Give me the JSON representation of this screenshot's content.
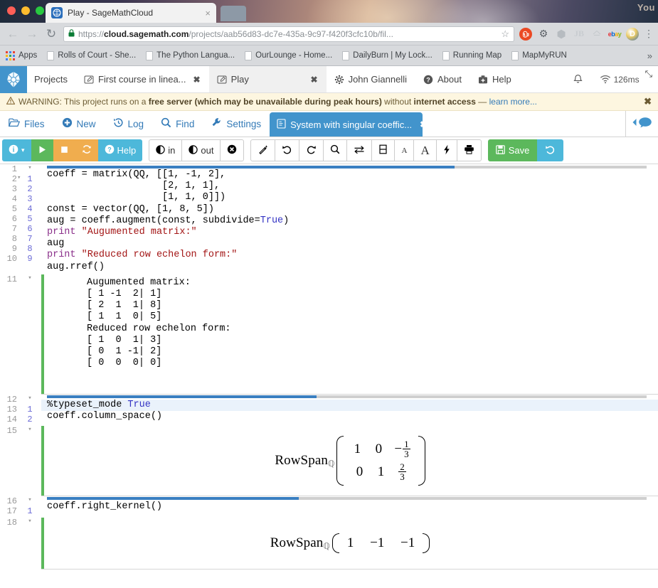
{
  "browser": {
    "tab_title": "Play - SageMathCloud",
    "tab_close": "×",
    "back_icon": "←",
    "forward_icon": "→",
    "reload_icon": "↻",
    "lock_icon": "🔒",
    "url_prefix": "https://",
    "url_domain": "cloud.sagemath.com",
    "url_path": "/projects/aab56d83-dc7e-435a-9c97-f420f3cfc10b/fil...",
    "star_icon": "☆",
    "menu_icon": "⋮",
    "watermark": "You",
    "extensions": [
      {
        "name": "stumbleupon-extension-icon",
        "label": "su"
      },
      {
        "name": "bug-extension-icon",
        "label": "⚙"
      },
      {
        "name": "box-extension-icon",
        "label": "⬢"
      },
      {
        "name": "jb-extension-icon",
        "label": "JB"
      },
      {
        "name": "amazon-extension-icon",
        "label": "a"
      },
      {
        "name": "ebay-extension-icon",
        "label": "ebay"
      },
      {
        "name": "d-extension-icon",
        "label": "D"
      }
    ],
    "bookmarks": [
      {
        "label": "Apps",
        "icon": "apps-grid-icon"
      },
      {
        "label": "Rolls of Court - She...",
        "icon": "page-icon"
      },
      {
        "label": "The Python Langua...",
        "icon": "page-icon"
      },
      {
        "label": "OurLounge - Home...",
        "icon": "page-icon"
      },
      {
        "label": "DailyBurn | My Lock...",
        "icon": "page-icon"
      },
      {
        "label": "Running Map",
        "icon": "page-icon"
      },
      {
        "label": "MapMyRUN",
        "icon": "page-icon"
      }
    ],
    "bookmarks_overflow": "»"
  },
  "smc_nav": {
    "projects": "Projects",
    "tabs": [
      {
        "label": "First course in linea...",
        "icon": "edit-icon",
        "close": "✖",
        "active": false
      },
      {
        "label": "Play",
        "icon": "edit-icon",
        "close": "✖",
        "active": true
      }
    ],
    "account": "John Giannelli",
    "about": "About",
    "help": "Help",
    "bell_icon": "🔔",
    "wifi_icon": "◔",
    "ping": "126ms",
    "pin_icon": "⤡"
  },
  "warning": {
    "icon": "⚠",
    "prefix": "WARNING: This project runs on a ",
    "bold1": "free server (which may be unavailable during peak hours)",
    "middle": " without ",
    "bold2": "internet access",
    "dash": " — ",
    "link": "learn more...",
    "close": "✖"
  },
  "project_tabs": {
    "items": [
      {
        "label": "Files",
        "icon": "folder-icon"
      },
      {
        "label": "New",
        "icon": "plus-circle-icon"
      },
      {
        "label": "Log",
        "icon": "history-icon"
      },
      {
        "label": "Find",
        "icon": "search-icon"
      },
      {
        "label": "Settings",
        "icon": "wrench-icon"
      }
    ],
    "file_tab": {
      "label": "System with singular coeffic...",
      "icon": "worksheet-icon",
      "close": "✖"
    },
    "chat_icon": "chat-bubble-icon"
  },
  "toolbar": {
    "info_label": "",
    "info_caret": "▾",
    "run_label": "▶",
    "stop_label": "■",
    "restart_label": "⟳",
    "help_label": "Help",
    "tighten_in": "in",
    "tighten_out": "out",
    "clear_label": "",
    "format_label": "",
    "undo_label": "↶",
    "redo_label": "↷",
    "find_label": "",
    "swap_label": "⇄",
    "split_label": "",
    "font_small": "A",
    "font_large": "A",
    "bolt_label": "⚡",
    "print_label": "",
    "save_label": "Save",
    "timetravel_label": "↺"
  },
  "worksheet": {
    "cells": [
      {
        "id": "cell-1",
        "type": "input",
        "progress_pct": 68,
        "gutter": [
          {
            "n": "1",
            "n2": "",
            "caret": true
          },
          {
            "n": "2",
            "n2": "1",
            "caret": true
          },
          {
            "n": "3",
            "n2": "2",
            "caret": false
          },
          {
            "n": "4",
            "n2": "3",
            "caret": false
          },
          {
            "n": "5",
            "n2": "4",
            "caret": false
          },
          {
            "n": "6",
            "n2": "5",
            "caret": false
          },
          {
            "n": "7",
            "n2": "6",
            "caret": false
          },
          {
            "n": "8",
            "n2": "7",
            "caret": false
          },
          {
            "n": "9",
            "n2": "8",
            "caret": false
          },
          {
            "n": "10",
            "n2": "9",
            "caret": false
          }
        ],
        "lines": [
          "coeff = matrix(QQ, [[1, -1, 2],",
          "                    [2, 1, 1],",
          "                    [1, 1, 0]])",
          "const = vector(QQ, [1, 8, 5])",
          "aug = coeff.augment(const, subdivide=True)",
          "print \"Augumented matrix:\"",
          "aug",
          "print \"Reduced row echelon form:\"",
          "aug.rref()"
        ]
      },
      {
        "id": "cell-1-output",
        "type": "output",
        "gutter": [
          {
            "n": "11",
            "n2": "",
            "caret": true
          }
        ],
        "lines": [
          "Augumented matrix:",
          "[ 1 -1  2| 1]",
          "[ 2  1  1| 8]",
          "[ 1  1  0| 5]",
          "Reduced row echelon form:",
          "[ 1  0  1| 3]",
          "[ 0  1 -1| 2]",
          "[ 0  0  0| 0]"
        ]
      },
      {
        "id": "cell-2",
        "type": "input",
        "progress_pct": 45,
        "gutter": [
          {
            "n": "12",
            "n2": "",
            "caret": true
          },
          {
            "n": "13",
            "n2": "1",
            "caret": false
          },
          {
            "n": "14",
            "n2": "2",
            "caret": false
          }
        ],
        "lines": [
          "%typeset_mode True",
          "coeff.column_space()"
        ]
      },
      {
        "id": "cell-2-output",
        "type": "math",
        "gutter": [
          {
            "n": "15",
            "n2": "",
            "caret": true
          }
        ],
        "math": {
          "label": "RowSpan",
          "field": "ℚ",
          "kind": "matrix",
          "rows": [
            [
              "1",
              "0",
              "-1/3"
            ],
            [
              "0",
              "1",
              "2/3"
            ]
          ]
        }
      },
      {
        "id": "cell-3",
        "type": "input",
        "progress_pct": 42,
        "gutter": [
          {
            "n": "16",
            "n2": "",
            "caret": true
          },
          {
            "n": "17",
            "n2": "1",
            "caret": false
          }
        ],
        "lines": [
          "coeff.right_kernel()"
        ]
      },
      {
        "id": "cell-3-output",
        "type": "math",
        "gutter": [
          {
            "n": "18",
            "n2": "",
            "caret": true
          }
        ],
        "math": {
          "label": "RowSpan",
          "field": "ℚ",
          "kind": "rowvector",
          "rows": [
            [
              "1",
              "−1",
              "−1"
            ]
          ]
        }
      }
    ]
  },
  "colors": {
    "accent_blue": "#4294cc",
    "green": "#5cb85c",
    "orange": "#f0ad4e",
    "warning_bg": "#fdf6e0",
    "string_red": "#a31515",
    "keyword_blue": "#3434c4"
  }
}
